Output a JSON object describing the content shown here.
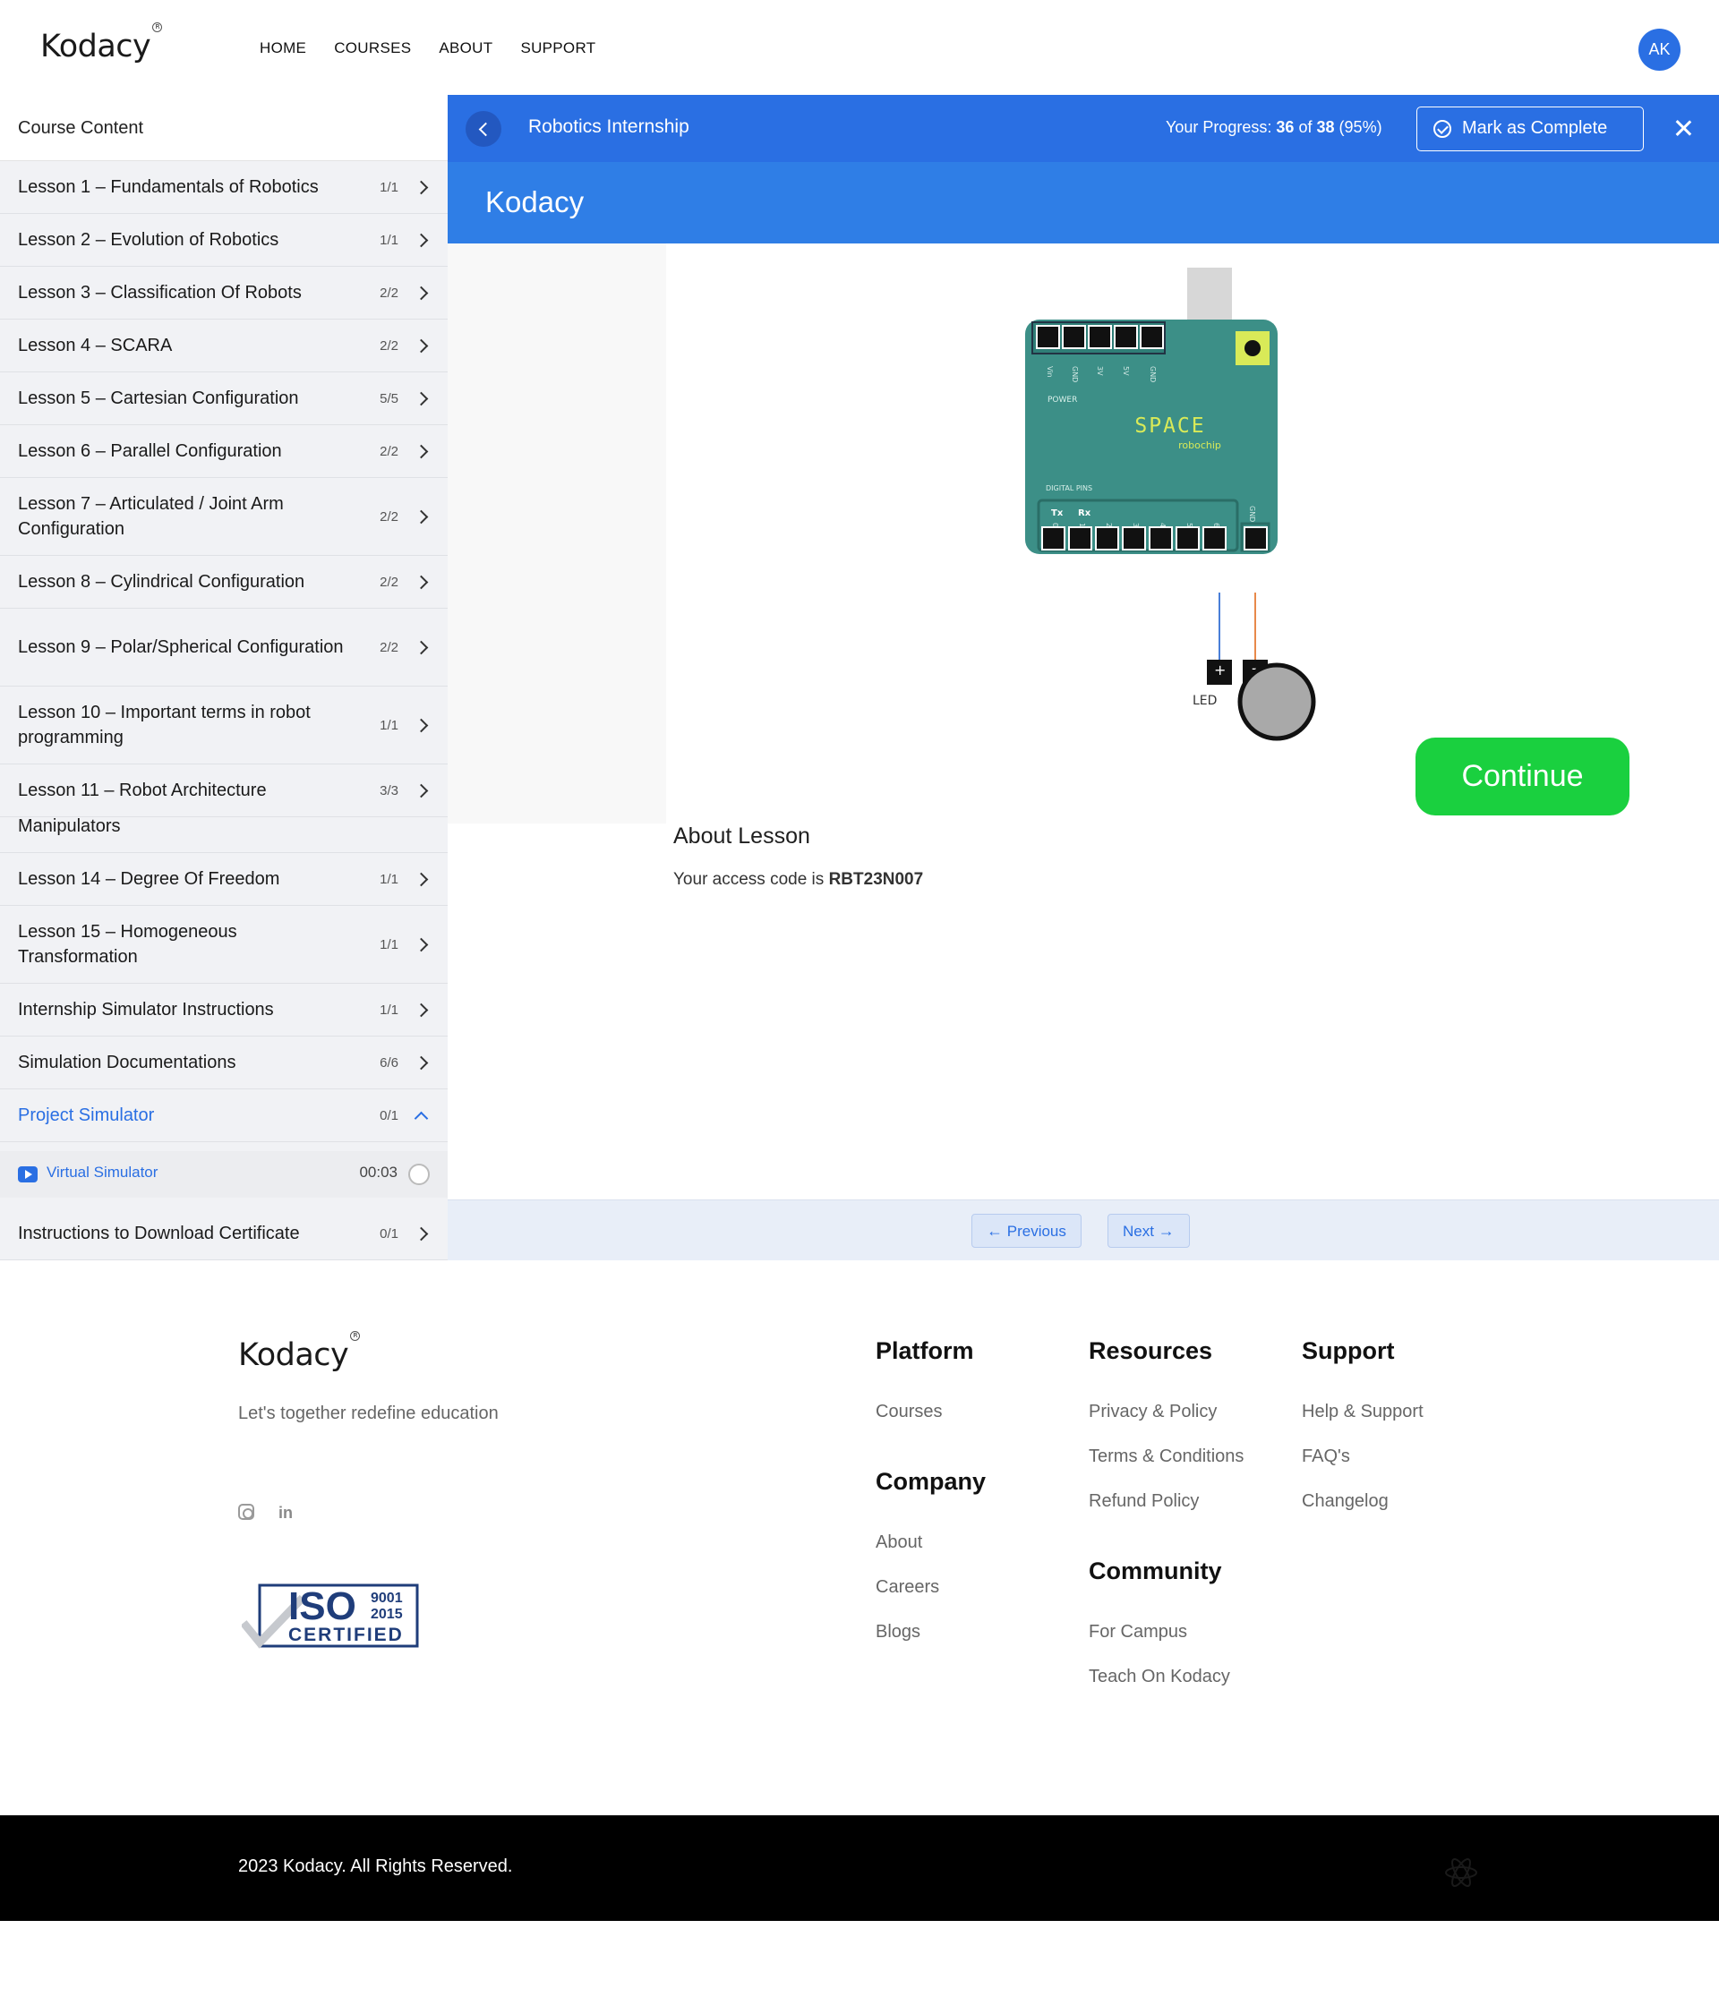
{
  "header": {
    "logo": "Kodacy",
    "nav": [
      "HOME",
      "COURSES",
      "ABOUT",
      "SUPPORT"
    ],
    "avatar": "AK"
  },
  "sidebar": {
    "title": "Course Content",
    "lessons": [
      {
        "title": "Lesson 1 – Fundamentals of Robotics",
        "count": "1/1"
      },
      {
        "title": "Lesson 2 – Evolution of Robotics",
        "count": "1/1"
      },
      {
        "title": "Lesson 3 – Classification Of Robots",
        "count": "2/2"
      },
      {
        "title": "Lesson 4 – SCARA",
        "count": "2/2"
      },
      {
        "title": "Lesson 5 – Cartesian Configuration",
        "count": "5/5"
      },
      {
        "title": "Lesson 6 – Parallel Configuration",
        "count": "2/2"
      },
      {
        "title": "Lesson 7 – Articulated / Joint Arm Configuration",
        "count": "2/2"
      },
      {
        "title": "Lesson 8 – Cylindrical Configuration",
        "count": "2/2"
      },
      {
        "title": "Lesson 9 – Polar/Spherical Configuration",
        "count": "2/2"
      },
      {
        "title": "Lesson 10 – Important terms in robot programming",
        "count": "1/1"
      },
      {
        "title": "Lesson 11 – Robot Architecture",
        "count": "3/3"
      },
      {
        "title": "Manipulators",
        "count": ""
      },
      {
        "title": "Lesson 14 – Degree Of Freedom",
        "count": "1/1"
      },
      {
        "title": "Lesson 15 – Homogeneous Transformation",
        "count": "1/1"
      },
      {
        "title": "Internship Simulator Instructions",
        "count": "1/1"
      },
      {
        "title": "Simulation Documentations",
        "count": "6/6"
      },
      {
        "title": "Project Simulator",
        "count": "0/1"
      },
      {
        "title": "Instructions to Download Certificate",
        "count": "0/1"
      }
    ],
    "sub_item": {
      "title": "Virtual Simulator",
      "time": "00:03"
    }
  },
  "lesson_bar": {
    "course_name": "Robotics Internship",
    "progress_label": "Your Progress:",
    "progress_done": "36",
    "progress_of": "of",
    "progress_total": "38",
    "progress_pct": "(95%)",
    "mark_complete": "Mark as Complete"
  },
  "banner": {
    "title": "Kodacy"
  },
  "diagram": {
    "power_pins": [
      "Vin",
      "GND",
      "3V",
      "5V",
      "GND"
    ],
    "power_label": "POWER",
    "brand": "SPACE",
    "brand_sub": "robochip",
    "digital_label": "DIGITAL PINS",
    "tx": "Tx",
    "rx": "Rx",
    "digital_pins": [
      "0",
      "1",
      "2",
      "3",
      "4",
      "5",
      "6"
    ],
    "gnd": "GND",
    "led_label": "LED",
    "wire_colors": {
      "plus": "#4a7fd8",
      "minus": "#e8894a"
    },
    "board_color": "#3c8f87"
  },
  "main": {
    "continue": "Continue",
    "about_heading": "About Lesson",
    "access_text": "Your access code is",
    "access_code": "RBT23N007"
  },
  "pager": {
    "previous": "Previous",
    "next": "Next"
  },
  "footer": {
    "logo": "Kodacy",
    "tagline": "Let's together redefine education",
    "iso": {
      "main": "ISO",
      "num1": "9001",
      "num2": "2015",
      "certified": "CERTIFIED"
    },
    "platform": {
      "heading": "Platform",
      "links": [
        "Courses"
      ]
    },
    "company": {
      "heading": "Company",
      "links": [
        "About",
        "Careers",
        "Blogs"
      ]
    },
    "resources": {
      "heading": "Resources",
      "links": [
        "Privacy & Policy",
        "Terms & Conditions",
        "Refund Policy"
      ]
    },
    "community": {
      "heading": "Community",
      "links": [
        "For Campus",
        "Teach On Kodacy"
      ]
    },
    "support": {
      "heading": "Support",
      "links": [
        "Help & Support",
        "FAQ's",
        "Changelog"
      ]
    },
    "copyright": "2023 Kodacy. All Rights Reserved."
  },
  "colors": {
    "accent": "#2a6fe3",
    "continue": "#1ad03f",
    "banner": "#2f7ee6"
  }
}
